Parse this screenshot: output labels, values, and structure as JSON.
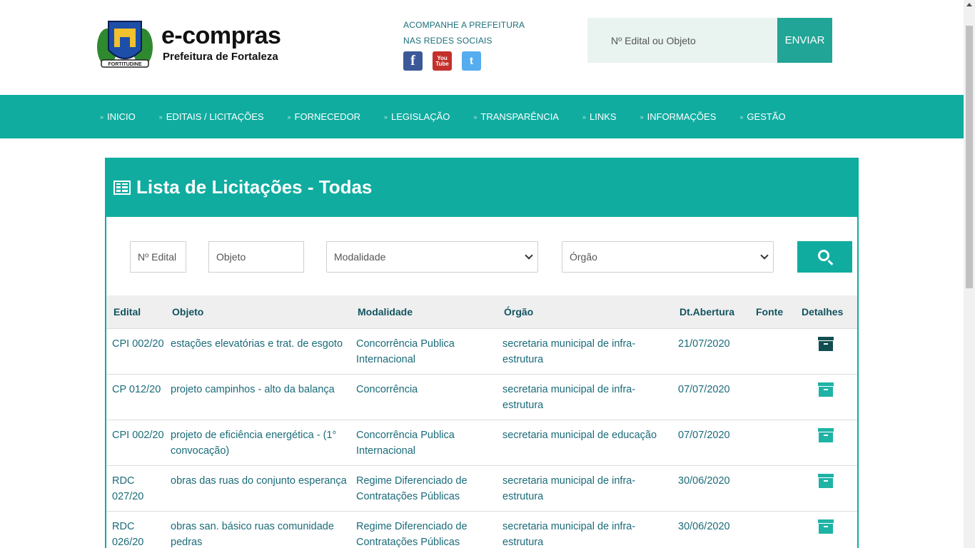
{
  "header": {
    "brand": "e-compras",
    "subtitle": "Prefeitura de Fortaleza",
    "seal_text": "FORTITUDINE",
    "social_line1": "ACOMPANHE A PREFEITURA",
    "social_line2": "NAS REDES SOCIAIS",
    "social_icons": [
      "facebook-icon",
      "youtube-icon",
      "twitter-icon"
    ],
    "youtube_text_1": "You",
    "youtube_text_2": "Tube",
    "facebook_glyph": "f",
    "twitter_glyph": "t",
    "search_placeholder": "Nº Edital ou Objeto",
    "search_button": "ENVIAR"
  },
  "nav": {
    "items": [
      "INICIO",
      "EDITAIS / LICITAÇÕES",
      "FORNECEDOR",
      "LEGISLAÇÃO",
      "TRANSPARÊNCIA",
      "LINKS",
      "INFORMAÇÕES",
      "GESTÃO"
    ]
  },
  "panel": {
    "title": "Lista de Licitações - Todas",
    "filters": {
      "edital_placeholder": "Nº Edital",
      "objeto_placeholder": "Objeto",
      "modalidade": "Modalidade",
      "orgao": "Órgão"
    },
    "columns": [
      "Edital",
      "Objeto",
      "Modalidade",
      "Órgão",
      "Dt.Abertura",
      "Fonte",
      "Detalhes"
    ],
    "rows": [
      {
        "edital": "CPI 002/20",
        "objeto": "estações elevatórias e trat. de esgoto",
        "modalidade": "Concorrência Publica Internacional",
        "orgao": "secretaria municipal de infra-estrutura",
        "data": "21/07/2020",
        "fonte": "",
        "icon_active": true
      },
      {
        "edital": "CP 012/20",
        "objeto": "projeto campinhos - alto da balança",
        "modalidade": "Concorrência",
        "orgao": "secretaria municipal de infra-estrutura",
        "data": "07/07/2020",
        "fonte": "",
        "icon_active": false
      },
      {
        "edital": "CPI 002/20",
        "objeto": "projeto de eficiência energética - (1° convocação)",
        "modalidade": "Concorrência Publica Internacional",
        "orgao": "secretaria municipal de educação",
        "data": "07/07/2020",
        "fonte": "",
        "icon_active": false
      },
      {
        "edital": "RDC 027/20",
        "objeto": "obras das ruas do conjunto esperança",
        "modalidade": "Regime Diferenciado de Contratações Públicas",
        "orgao": "secretaria municipal de infra-estrutura",
        "data": "30/06/2020",
        "fonte": "",
        "icon_active": false
      },
      {
        "edital": "RDC 026/20",
        "objeto": "obras san. básico ruas comunidade pedras",
        "modalidade": "Regime Diferenciado de Contratações Públicas",
        "orgao": "secretaria municipal de infra-estrutura",
        "data": "30/06/2020",
        "fonte": "",
        "icon_active": false
      }
    ]
  },
  "colors": {
    "teal": "#10aca0",
    "icon_dark": "#124e50",
    "icon_light": "#1fb3a6"
  }
}
